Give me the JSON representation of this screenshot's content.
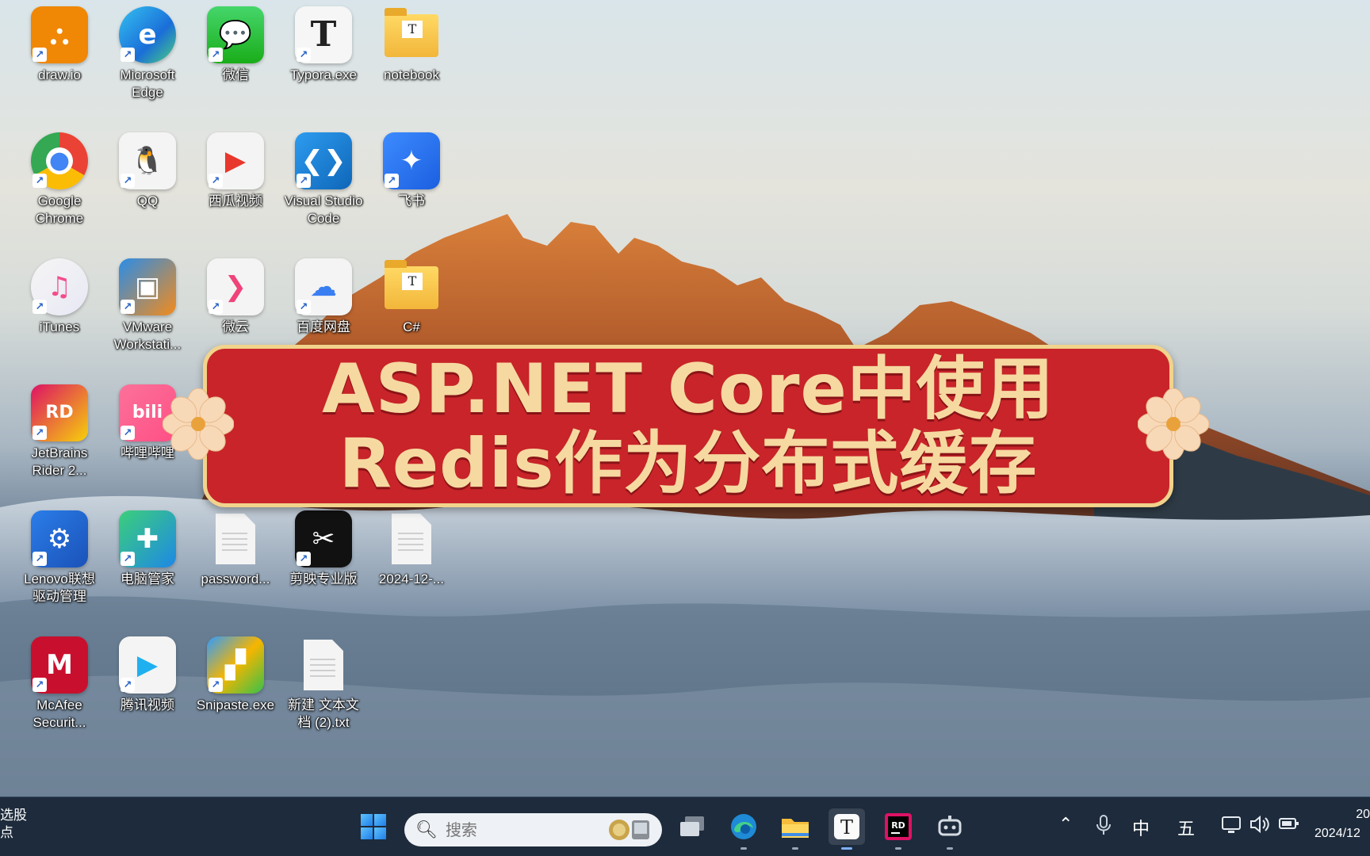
{
  "desktop": {
    "icons": [
      {
        "label": "draw.io",
        "icon": "drawio-icon"
      },
      {
        "label": "Microsoft Edge",
        "icon": "edge-icon"
      },
      {
        "label": "微信",
        "icon": "wechat-icon"
      },
      {
        "label": "Typora.exe",
        "icon": "typora-icon"
      },
      {
        "label": "notebook",
        "icon": "folder-icon"
      },
      {
        "label": "Google Chrome",
        "icon": "chrome-icon"
      },
      {
        "label": "QQ",
        "icon": "qq-icon"
      },
      {
        "label": "西瓜视频",
        "icon": "xigua-icon"
      },
      {
        "label": "Visual Studio Code",
        "icon": "vscode-icon"
      },
      {
        "label": "飞书",
        "icon": "feishu-icon"
      },
      {
        "label": "iTunes",
        "icon": "itunes-icon"
      },
      {
        "label": "VMware Workstati...",
        "icon": "vmware-icon"
      },
      {
        "label": "微云",
        "icon": "weiyun-icon"
      },
      {
        "label": "百度网盘",
        "icon": "baidu-netdisk-icon"
      },
      {
        "label": "C#",
        "icon": "folder-icon"
      },
      {
        "label": "JetBrains Rider 2...",
        "icon": "rider-icon"
      },
      {
        "label": "哔哩哔哩",
        "icon": "bilibili-icon"
      },
      {
        "label": "Lenovo联想 驱动管理",
        "icon": "lenovo-driver-icon"
      },
      {
        "label": "电脑管家",
        "icon": "pc-manager-icon"
      },
      {
        "label": "password...",
        "icon": "document-icon"
      },
      {
        "label": "剪映专业版",
        "icon": "capcut-icon"
      },
      {
        "label": "2024-12-...",
        "icon": "document-icon"
      },
      {
        "label": "McAfee Securit...",
        "icon": "mcafee-icon"
      },
      {
        "label": "腾讯视频",
        "icon": "tencent-video-icon"
      },
      {
        "label": "Snipaste.exe",
        "icon": "snipaste-icon"
      },
      {
        "label": "新建 文本文 档 (2).txt",
        "icon": "document-icon"
      }
    ]
  },
  "banner": {
    "line1": "ASP.NET  Core中使用",
    "line2": "Redis作为分布式缓存"
  },
  "taskbar": {
    "left_text_1": "选股",
    "left_text_2": "点",
    "search_placeholder": "搜索",
    "tray_ime": "中",
    "tray_ime2": "五",
    "clock_time": "20",
    "clock_date": "2024/12"
  }
}
